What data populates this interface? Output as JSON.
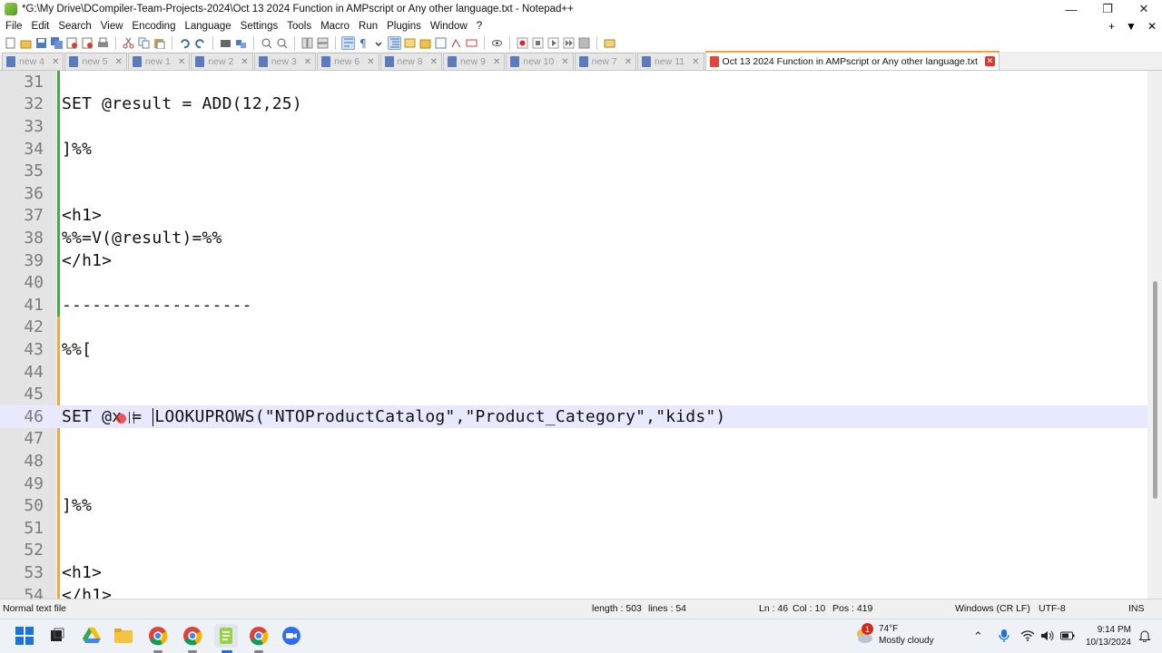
{
  "window": {
    "title": "*G:\\My Drive\\DCompiler-Team-Projects-2024\\Oct 13 2024 Function in AMPscript or Any other language.txt - Notepad++",
    "controls": [
      "—",
      "❐",
      "✕"
    ]
  },
  "menu": {
    "items": [
      "File",
      "Edit",
      "Search",
      "View",
      "Encoding",
      "Language",
      "Settings",
      "Tools",
      "Macro",
      "Run",
      "Plugins",
      "Window",
      "?"
    ],
    "right": [
      "+",
      "▼",
      "✕"
    ]
  },
  "tabs": [
    {
      "label": "new 4",
      "active": false
    },
    {
      "label": "new 5",
      "active": false
    },
    {
      "label": "new 1",
      "active": false
    },
    {
      "label": "new 2",
      "active": false
    },
    {
      "label": "new 3",
      "active": false
    },
    {
      "label": "new 6",
      "active": false
    },
    {
      "label": "new 8",
      "active": false
    },
    {
      "label": "new 9",
      "active": false
    },
    {
      "label": "new 10",
      "active": false
    },
    {
      "label": "new 7",
      "active": false
    },
    {
      "label": "new 11",
      "active": false
    },
    {
      "label": "Oct 13 2024 Function in AMPscript or Any other language.txt",
      "active": true
    }
  ],
  "editor": {
    "current_line": 46,
    "lines": [
      {
        "num": "31",
        "text": ""
      },
      {
        "num": "32",
        "text": "SET @result = ADD(12,25)"
      },
      {
        "num": "33",
        "text": ""
      },
      {
        "num": "34",
        "text": "]%%"
      },
      {
        "num": "35",
        "text": ""
      },
      {
        "num": "36",
        "text": ""
      },
      {
        "num": "37",
        "text": "<h1>"
      },
      {
        "num": "38",
        "text": "%%=V(@result)=%%"
      },
      {
        "num": "39",
        "text": "</h1>"
      },
      {
        "num": "40",
        "text": ""
      },
      {
        "num": "41",
        "text": "-------------------"
      },
      {
        "num": "42",
        "text": ""
      },
      {
        "num": "43",
        "text": "%%["
      },
      {
        "num": "44",
        "text": ""
      },
      {
        "num": "45",
        "text": ""
      },
      {
        "num": "46",
        "text_before": "SET @x = ",
        "text_after": "LOOKUPROWS(\"NTOProductCatalog\",\"Product_Category\",\"kids\")"
      },
      {
        "num": "47",
        "text": ""
      },
      {
        "num": "48",
        "text": ""
      },
      {
        "num": "49",
        "text": ""
      },
      {
        "num": "50",
        "text": "]%%"
      },
      {
        "num": "51",
        "text": ""
      },
      {
        "num": "52",
        "text": ""
      },
      {
        "num": "53",
        "text": "<h1>"
      },
      {
        "num": "54",
        "text": "</h1>"
      }
    ]
  },
  "status": {
    "file_type": "Normal text file",
    "length": "length : 503",
    "lines": "lines : 54",
    "ln": "Ln : 46",
    "col": "Col : 10",
    "pos": "Pos : 419",
    "eol": "Windows (CR LF)",
    "encoding": "UTF-8",
    "mode": "INS"
  },
  "taskbar": {
    "weather_badge": "1",
    "temperature": "74°F",
    "condition": "Mostly cloudy",
    "time": "9:14 PM",
    "date": "10/13/2024"
  },
  "colors": {
    "active_tab_accent": "#f7a13b",
    "current_line_bg": "#e8e8ff",
    "change_saved": "#3fae3f",
    "change_unsaved": "#f6a341",
    "gutter_bg": "#e4e4e4"
  }
}
